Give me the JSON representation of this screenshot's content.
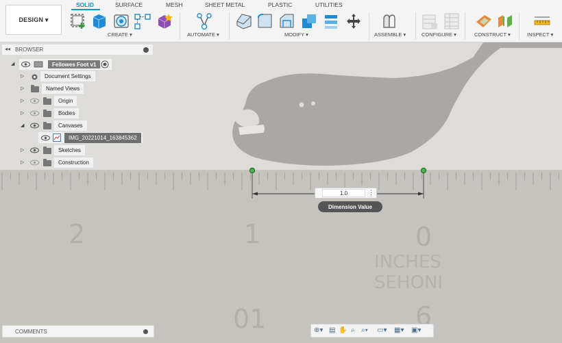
{
  "toolbar": {
    "workspace_button": "DESIGN ▾",
    "tabs": [
      "SOLID",
      "SURFACE",
      "MESH",
      "SHEET METAL",
      "PLASTIC",
      "UTILITIES"
    ],
    "groups": {
      "create": "CREATE ▾",
      "automate": "AUTOMATE ▾",
      "modify": "MODIFY ▾",
      "assemble": "ASSEMBLE ▾",
      "configure": "CONFIGURE ▾",
      "construct": "CONSTRUCT ▾",
      "inspect": "INSPECT ▾"
    },
    "accent": "#0696d7"
  },
  "browser": {
    "title": "BROWSER",
    "root": "Fellowes Foot v1",
    "items": [
      {
        "label": "Document Settings",
        "icon": "gear-icon"
      },
      {
        "label": "Named Views",
        "icon": "folder-icon"
      },
      {
        "label": "Origin",
        "icon": "folder-icon"
      },
      {
        "label": "Bodies",
        "icon": "folder-icon"
      },
      {
        "label": "Canvases",
        "icon": "folder-icon"
      },
      {
        "label": "IMG_20221014_163845362",
        "icon": "canvas-image-icon"
      },
      {
        "label": "Sketches",
        "icon": "folder-icon"
      },
      {
        "label": "Construction",
        "icon": "folder-icon"
      }
    ]
  },
  "canvas": {
    "ruler_numbers": [
      "2",
      "1",
      "0",
      "01",
      "6"
    ],
    "ruler_text": [
      "INCHES",
      "SEHONI"
    ],
    "dimension_value": "1.0",
    "dimension_tooltip": "Dimension Value"
  },
  "comments": {
    "title": "COMMENTS"
  }
}
